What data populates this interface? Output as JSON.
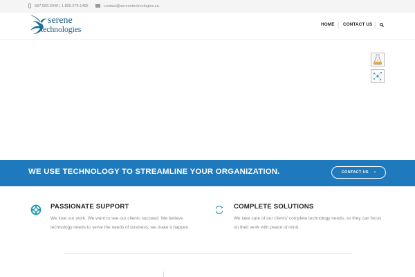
{
  "topbar": {
    "phone": "587.689.2040 | 1.800.279.1455",
    "email": "contact@serenetechnologies.ca"
  },
  "logo": {
    "line1": "serene",
    "line2": "technologies"
  },
  "nav": {
    "home": "HOME",
    "contact": "CONTACT US"
  },
  "banner": {
    "headline": "WE USE TECHNOLOGY TO STREAMLINE YOUR ORGANIZATION.",
    "button_label": "CONTACT US",
    "button_arrow": "›"
  },
  "features": [
    {
      "title": "PASSIONATE SUPPORT",
      "description": "We love our work. We want to see our clients succeed. We believe technology needs to serve the needs of business; we make it happen.",
      "icon": "lifebuoy-icon"
    },
    {
      "title": "COMPLETE SOLUTIONS",
      "description": "We take care of our clients' complete technology needs, so they can focus on their work with peace of mind.",
      "icon": "refresh-icon"
    }
  ],
  "colors": {
    "brand_blue": "#1f79bd",
    "logo_blue": "#1e5f86",
    "icon_teal": "#1c9bb0"
  }
}
